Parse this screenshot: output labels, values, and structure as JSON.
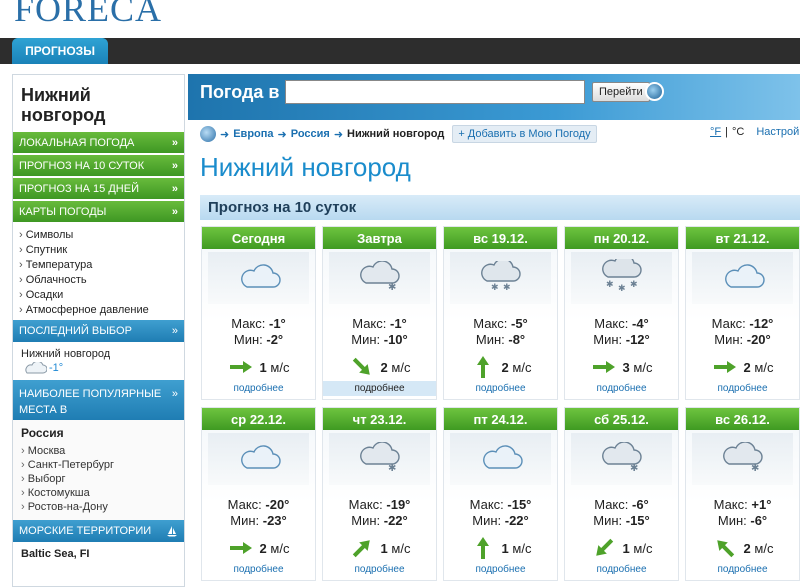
{
  "logo_text": "FORECA",
  "top_tab": "ПРОГНОЗЫ",
  "sidebar": {
    "city": "Нижний новгород",
    "green_items": [
      {
        "label": "ЛОКАЛЬНАЯ ПОГОДА",
        "chev": "»"
      },
      {
        "label": "ПРОГНОЗ НА 10 СУТОК",
        "chev": "»"
      },
      {
        "label": "ПРОГНОЗ НА 15 ДНЕЙ",
        "chev": "»"
      },
      {
        "label": "КАРТЫ ПОГОДЫ",
        "chev": "»"
      }
    ],
    "map_items": [
      "Символы",
      "Спутник",
      "Температура",
      "Облачность",
      "Осадки",
      "Атмосферное давление"
    ],
    "last_pick_label": "ПОСЛЕДНИЙ ВЫБОР",
    "last_pick_city": "Нижний новгород",
    "last_pick_temp": "-1°",
    "popular_label": "НАИБОЛЕЕ ПОПУЛЯРНЫЕ МЕСТА В",
    "country": "Россия",
    "popular_places": [
      "Москва",
      "Санкт-Петербург",
      "Выборг",
      "Костомукша",
      "Ростов-на-Дону"
    ],
    "sea_label": "МОРСКИЕ ТЕРРИТОРИИ",
    "sea_item": "Baltic Sea, FI"
  },
  "search": {
    "label": "Погода в",
    "value": "",
    "go_label": "Перейти"
  },
  "breadcrumb": {
    "europe": "Европа",
    "russia": "Россия",
    "current": "Нижний новгород",
    "add": "+ Добавить в Мою Погоду",
    "unit_f": "°F",
    "sep": "|",
    "unit_c": "°C",
    "settings": "Настройки"
  },
  "page_title": "Нижний новгород",
  "forecast_title": "Прогноз на 10 суток",
  "labels": {
    "max": "Макс:",
    "min": "Мин:",
    "ms": "м/с"
  },
  "days": [
    {
      "day": "Сегодня",
      "max": "-1°",
      "min": "-2°",
      "wind": "1",
      "icon": "cloud-icon",
      "more": "подробнее",
      "highlight": false
    },
    {
      "day": "Завтра",
      "max": "-1°",
      "min": "-10°",
      "wind": "2",
      "icon": "cloud-snow-icon",
      "more": "подробнее",
      "highlight": true
    },
    {
      "day": "вс 19.12.",
      "max": "-5°",
      "min": "-8°",
      "wind": "2",
      "icon": "cloud-heavy-snow-icon",
      "more": "подробнее",
      "highlight": false
    },
    {
      "day": "пн 20.12.",
      "max": "-4°",
      "min": "-12°",
      "wind": "3",
      "icon": "snow-heavy-icon",
      "more": "подробнее",
      "highlight": false
    },
    {
      "day": "вт 21.12.",
      "max": "-12°",
      "min": "-20°",
      "wind": "2",
      "icon": "cloud-icon",
      "more": "подробнее",
      "highlight": false
    },
    {
      "day": "ср 22.12.",
      "max": "-20°",
      "min": "-23°",
      "wind": "2",
      "icon": "cloud-icon",
      "more": "подробнее",
      "highlight": false
    },
    {
      "day": "чт 23.12.",
      "max": "-19°",
      "min": "-22°",
      "wind": "1",
      "icon": "cloud-snow-icon",
      "more": "подробнее",
      "highlight": false
    },
    {
      "day": "пт 24.12.",
      "max": "-15°",
      "min": "-22°",
      "wind": "1",
      "icon": "cloud-icon",
      "more": "подробнее",
      "highlight": false
    },
    {
      "day": "сб 25.12.",
      "max": "-6°",
      "min": "-15°",
      "wind": "1",
      "icon": "cloud-snow-icon",
      "more": "подробнее",
      "highlight": false
    },
    {
      "day": "вс 26.12.",
      "max": "+1°",
      "min": "-6°",
      "wind": "2",
      "icon": "cloud-snow-icon",
      "more": "подробнее",
      "highlight": false
    }
  ]
}
